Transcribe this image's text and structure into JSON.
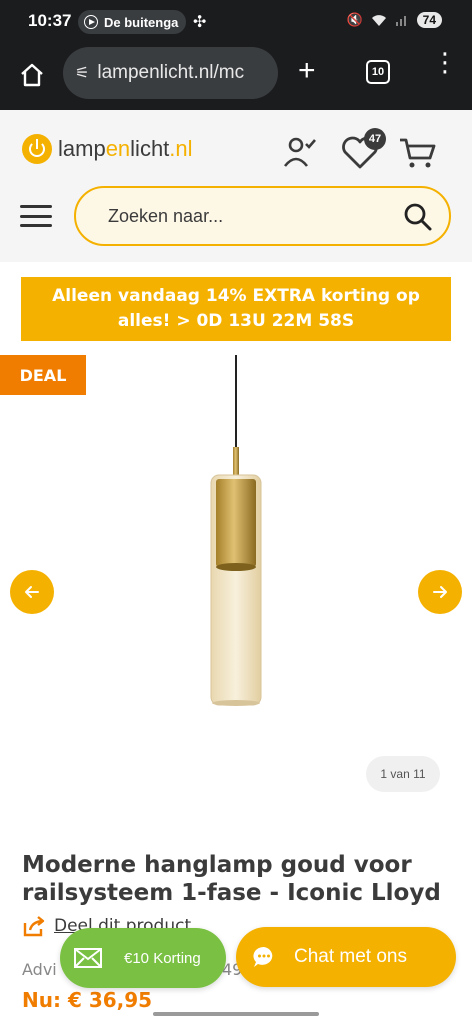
{
  "status_bar": {
    "time": "10:37",
    "media_pill": "De buitenga",
    "battery": "74",
    "icons": [
      "play-icon",
      "fan-icon",
      "mute-icon",
      "wifi-icon",
      "signal-icon"
    ]
  },
  "browser": {
    "url": "lampenlicht.nl/mc",
    "tab_count": "10",
    "icons": [
      "home-icon",
      "site-settings-icon",
      "new-tab-icon",
      "tabs-icon",
      "overflow-menu-icon"
    ]
  },
  "header": {
    "logo_text_a": "lamp",
    "logo_text_b": "en",
    "logo_text_c": "licht",
    "logo_text_d": ".nl",
    "wishlist_count": "47",
    "search_placeholder": "Zoeken naar..."
  },
  "promo": {
    "text": "Alleen vandaag 14% EXTRA korting op alles! > 0D 13U 22M 58S"
  },
  "gallery": {
    "deal_label": "DEAL",
    "counter": "1 van 11"
  },
  "product": {
    "title": "Moderne hanglamp goud voor railsysteem 1-fase - Iconic Lloyd",
    "share_label": "Deel dit product",
    "advice_label": "Advi",
    "advice_tail": "49",
    "price_label": "Nu: € 36,95"
  },
  "fabs": {
    "korting_label": "€10 Korting",
    "chat_label": "Chat met ons"
  },
  "colors": {
    "brand_yellow": "#f5b100",
    "deal_orange": "#f07d00",
    "korting_green": "#7ac143",
    "text_dark": "#3b3b3b"
  }
}
